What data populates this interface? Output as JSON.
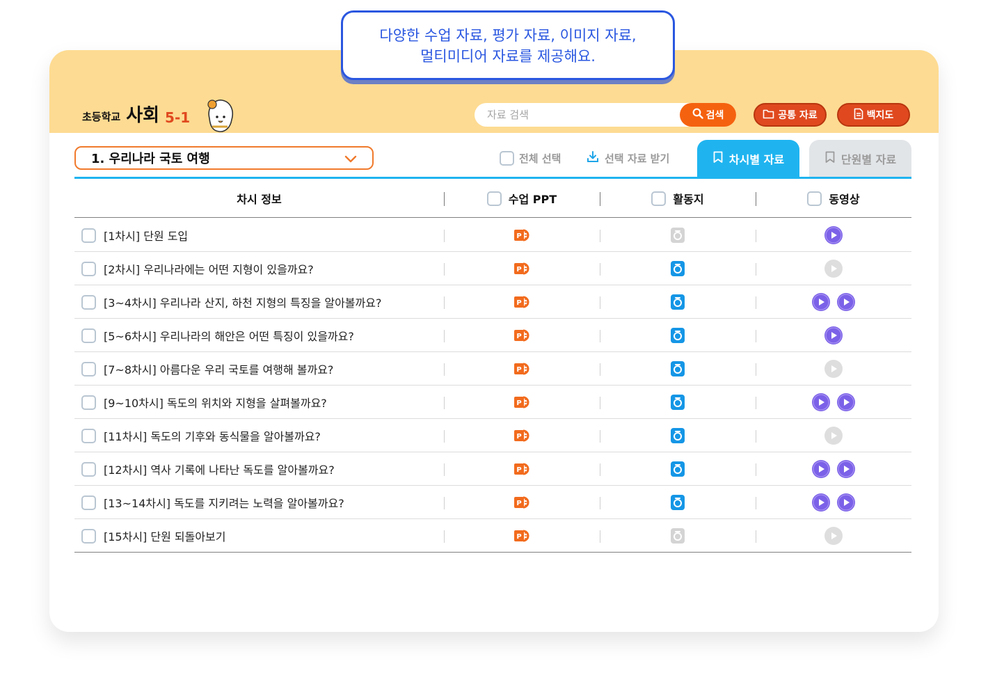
{
  "callout": {
    "line1": "다양한 수업 자료, 평가 자료, 이미지 자료,",
    "line2": "멀티미디어 자료를 제공해요."
  },
  "header": {
    "brand_small": "초등학교",
    "brand_big": "사회",
    "brand_grade": "5-1",
    "search_placeholder": "자료 검색",
    "search_button": "검색",
    "common_button": "공통 자료",
    "map_button": "백지도"
  },
  "unit_select": {
    "value": "1. 우리나라 국토 여행"
  },
  "toolbar": {
    "select_all": "전체 선택",
    "download_selected": "선택 자료 받기",
    "tab_lesson": "차시별 자료",
    "tab_unit": "단원별 자료"
  },
  "table": {
    "columns": [
      "차시 정보",
      "수업 PPT",
      "활동지",
      "동영상"
    ],
    "rows": [
      {
        "title": "[1차시] 단원 도입",
        "ppt": true,
        "sheet": false,
        "videos": 1,
        "video_active": true
      },
      {
        "title": "[2차시] 우리나라에는 어떤 지형이 있을까요?",
        "ppt": true,
        "sheet": true,
        "videos": 1,
        "video_active": false
      },
      {
        "title": "[3~4차시] 우리나라 산지, 하천 지형의 특징을 알아볼까요?",
        "ppt": true,
        "sheet": true,
        "videos": 2,
        "video_active": true
      },
      {
        "title": "[5~6차시] 우리나라의 해안은 어떤 특징이 있을까요?",
        "ppt": true,
        "sheet": true,
        "videos": 1,
        "video_active": true
      },
      {
        "title": "[7~8차시] 아름다운 우리 국토를 여행해 볼까요?",
        "ppt": true,
        "sheet": true,
        "videos": 1,
        "video_active": false
      },
      {
        "title": "[9~10차시] 독도의 위치와 지형을 살펴볼까요?",
        "ppt": true,
        "sheet": true,
        "videos": 2,
        "video_active": true
      },
      {
        "title": "[11차시] 독도의 기후와 동식물을 알아볼까요?",
        "ppt": true,
        "sheet": true,
        "videos": 1,
        "video_active": false
      },
      {
        "title": "[12차시] 역사 기록에 나타난 독도를 알아볼까요?",
        "ppt": true,
        "sheet": true,
        "videos": 2,
        "video_active": true
      },
      {
        "title": "[13~14차시] 독도를 지키려는 노력을 알아볼까요?",
        "ppt": true,
        "sheet": true,
        "videos": 2,
        "video_active": true
      },
      {
        "title": "[15차시] 단원 되돌아보기",
        "ppt": true,
        "sheet": false,
        "videos": 1,
        "video_active": false
      }
    ]
  },
  "colors": {
    "header_bg": "#fddb92",
    "accent_orange": "#f5620f",
    "button_red": "#e0491f",
    "tab_blue": "#1fb4f0",
    "callout_blue": "#2a57e0",
    "video_purple": "#7b61e8",
    "sheet_blue": "#1596e6"
  },
  "icons": {
    "ppt": "powerpoint-icon",
    "sheet": "worksheet-icon",
    "video": "play-icon",
    "search": "search-icon",
    "folder": "folder-icon",
    "document": "document-icon",
    "download": "download-icon",
    "bookmark": "bookmark-icon"
  }
}
